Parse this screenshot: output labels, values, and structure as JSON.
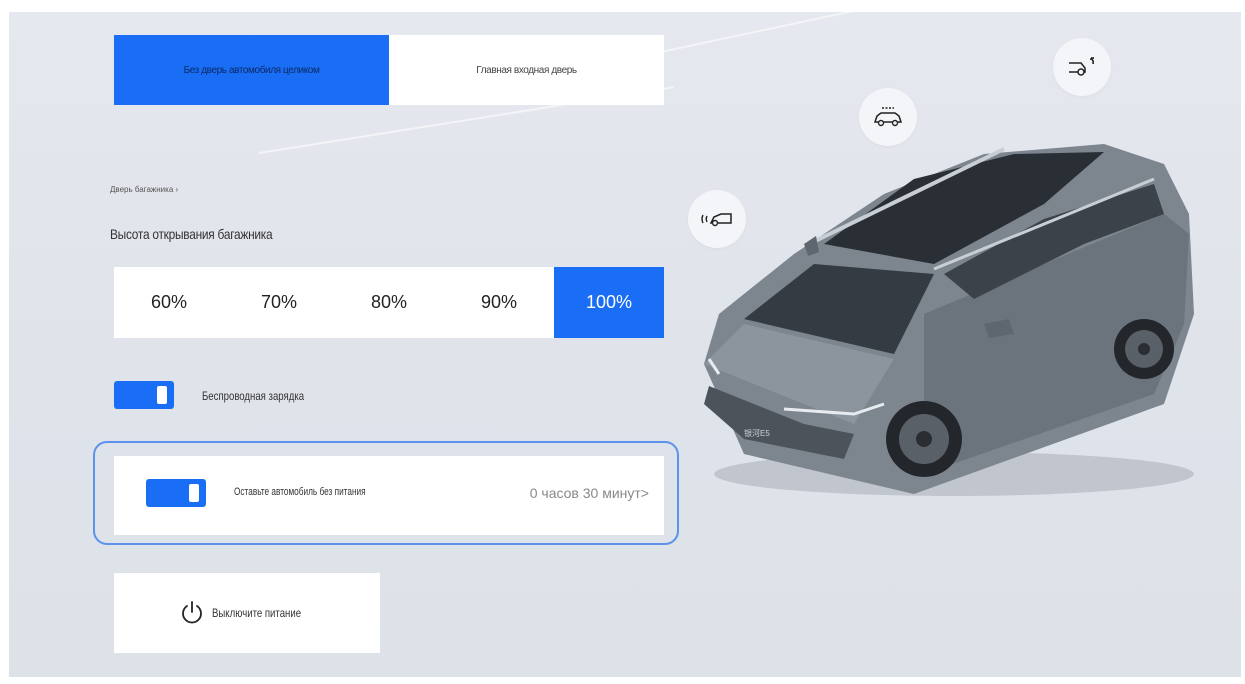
{
  "door_tabs": [
    {
      "label": "Без дверь автомобиля целиком",
      "active": true
    },
    {
      "label": "Главная входная дверь",
      "active": false
    }
  ],
  "small_label": "Дверь багажника ›",
  "trunk_height": {
    "title": "Высота открывания багажника",
    "options": [
      "60%",
      "70%",
      "80%",
      "90%",
      "100%"
    ],
    "selected": "100%"
  },
  "wireless_charging": {
    "label": "Беспроводная зарядка",
    "enabled": true
  },
  "power_keep": {
    "label": "Оставьте автомобиль без питания",
    "enabled": true,
    "value": "0 часов 30 минут>"
  },
  "power_off": {
    "label": "Выключите питание",
    "icon": "power-icon"
  },
  "quick_actions": [
    {
      "icon": "trunk-open-icon"
    },
    {
      "icon": "car-roof-icon"
    },
    {
      "icon": "car-front-signal-icon"
    }
  ],
  "car_badge": "银河E5",
  "colors": {
    "accent": "#1a6ef5",
    "outline": "#5b92ec"
  }
}
